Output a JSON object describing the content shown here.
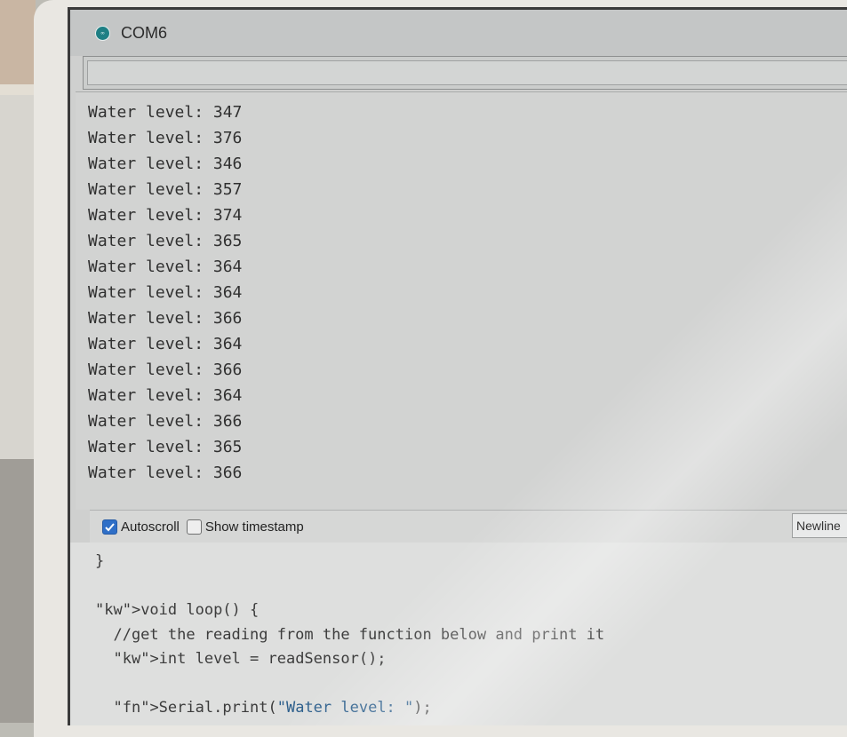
{
  "window": {
    "title": "COM6",
    "icon": "arduino-icon"
  },
  "send": {
    "value": ""
  },
  "output": {
    "lines": [
      "Water level: 347",
      "Water level: 376",
      "Water level: 346",
      "Water level: 357",
      "Water level: 374",
      "Water level: 365",
      "Water level: 364",
      "Water level: 364",
      "Water level: 366",
      "Water level: 364",
      "Water level: 366",
      "Water level: 364",
      "Water level: 366",
      "Water level: 365",
      "Water level: 366"
    ]
  },
  "options": {
    "autoscroll_label": "Autoscroll",
    "autoscroll_checked": true,
    "timestamp_label": "Show timestamp",
    "timestamp_checked": false,
    "line_ending": "Newline"
  },
  "editor": {
    "lines": [
      "}",
      "",
      "void loop() {",
      "  //get the reading from the function below and print it",
      "  int level = readSensor();",
      "",
      "  Serial.print(\"Water level: \");"
    ]
  },
  "colors": {
    "checkbox_accent": "#2f6fc7",
    "icon_teal": "#1f7f84"
  }
}
